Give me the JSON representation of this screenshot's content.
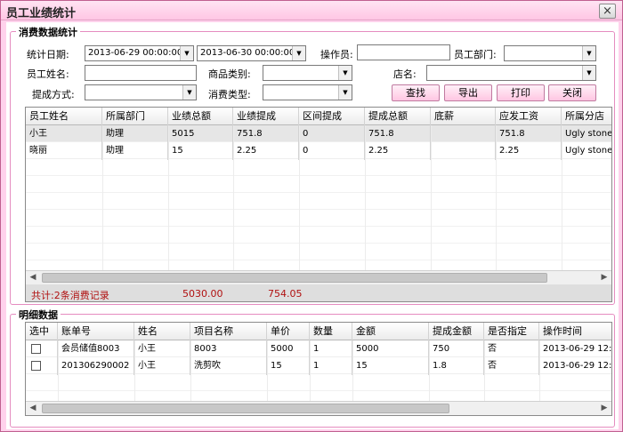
{
  "window": {
    "title": "员工业绩统计",
    "close_label": "×"
  },
  "summary_group": {
    "legend": "消费数据统计",
    "filters": {
      "date_label": "统计日期:",
      "date_from": "2013-06-29 00:00:00",
      "date_to": "2013-06-30 00:00:00",
      "operator_label": "操作员:",
      "operator_value": "",
      "dept_label": "员工部门:",
      "dept_value": "",
      "staff_label": "员工姓名:",
      "staff_value": "",
      "category_label": "商品类别:",
      "category_value": "",
      "store_label": "店名:",
      "store_value": "",
      "commission_label": "提成方式:",
      "commission_value": "",
      "consume_label": "消费类型:",
      "consume_value": ""
    },
    "buttons": {
      "search": "查找",
      "export": "导出",
      "print": "打印",
      "close": "关闭"
    },
    "table": {
      "columns": [
        "员工姓名",
        "所属部门",
        "业绩总额",
        "业绩提成",
        "区间提成",
        "提成总额",
        "底薪",
        "应发工资",
        "所属分店"
      ],
      "rows": [
        [
          "小王",
          "助理",
          "5015",
          "751.8",
          "0",
          "751.8",
          "",
          "751.8",
          "Ugly stone"
        ],
        [
          "晓丽",
          "助理",
          "15",
          "2.25",
          "0",
          "2.25",
          "",
          "2.25",
          "Ugly stone"
        ]
      ]
    },
    "totals": {
      "count_text": "共计:2条消费记录",
      "total_sales": "5030.00",
      "total_commission": "754.05"
    }
  },
  "detail_group": {
    "legend": "明细数据",
    "table": {
      "columns": [
        "选中",
        "账单号",
        "姓名",
        "项目名称",
        "单价",
        "数量",
        "金额",
        "提成金额",
        "是否指定",
        "操作时间"
      ],
      "rows": [
        [
          "",
          "会员储值8003",
          "小王",
          "8003",
          "5000",
          "1",
          "5000",
          "750",
          "否",
          "2013-06-29 12:3"
        ],
        [
          "",
          "201306290002",
          "小王",
          "洗剪吹",
          "15",
          "1",
          "15",
          "1.8",
          "否",
          "2013-06-29 12:3"
        ]
      ]
    }
  },
  "icons": {
    "dropdown": "chevron-down-icon",
    "scroll_left": "arrow-left-icon",
    "scroll_right": "arrow-right-icon",
    "close": "close-icon"
  },
  "colors": {
    "window_bg": "#ffd2ec",
    "group_border": "#e58cc0",
    "totals_text": "#b01010",
    "selected_row": "#e6e6e6"
  }
}
